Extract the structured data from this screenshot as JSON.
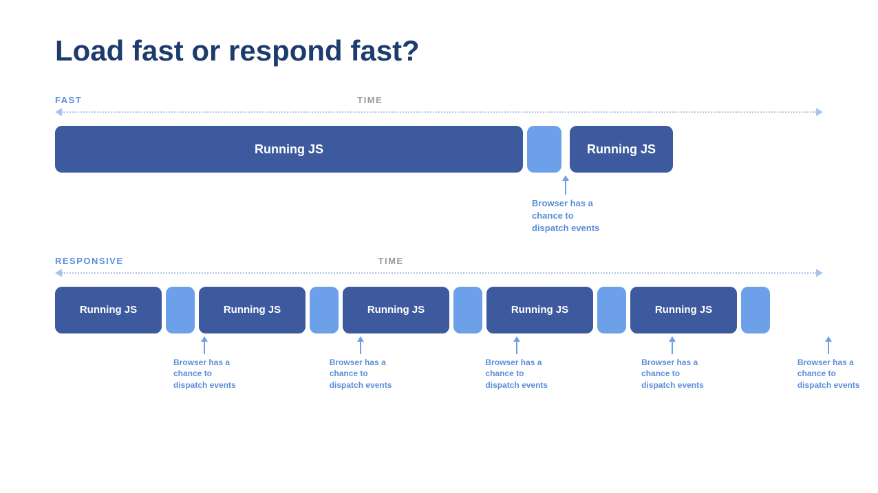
{
  "page": {
    "title": "Load fast or respond fast?",
    "fast_section": {
      "label": "FAST",
      "time_label": "TIME",
      "running_js_1": "Running JS",
      "running_js_2": "Running JS",
      "annotation": "Browser has a\nchance to\ndispatch events"
    },
    "responsive_section": {
      "label": "RESPONSIVE",
      "time_label": "TIME",
      "running_js": "Running JS",
      "annotations": [
        "Browser has a\nchance to\ndispatch events",
        "Browser has a\nchance to\ndispatch events",
        "Browser has a\nchance to\ndispatch events",
        "Browser has a\nchance to\ndispatch events",
        "Browser has a\nchance to\ndispatch events"
      ]
    }
  }
}
